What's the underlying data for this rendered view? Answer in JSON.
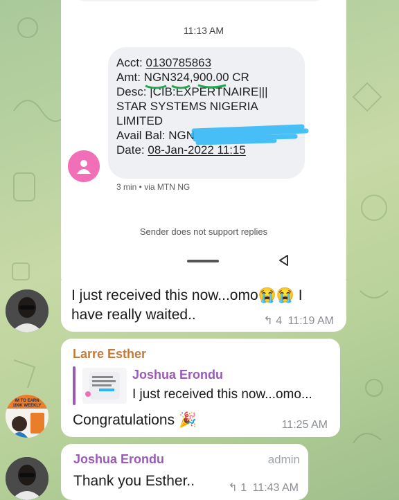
{
  "screenshot": {
    "time": "11:13 AM",
    "sms_lines": [
      "Acct: 0130785863",
      "Amt: NGN324,900.00 CR",
      "Desc: |CIB:EXPERTNAIRE|||",
      "STAR SYSTEMS NIGERIA",
      "LIMITED",
      "Avail Bal: NGN",
      "Date: 08-Jan-2022 11:15"
    ],
    "acct_label": "Acct: ",
    "acct_value": "0130785863",
    "amt_label": "Amt: ",
    "amt_value": "NGN324,900.00",
    "amt_suffix": " CR",
    "desc": "Desc: |CIB:EXPERTNAIRE|||",
    "desc2": "STAR SYSTEMS NIGERIA",
    "desc3": "LIMITED",
    "bal_label": "Avail Bal: NGN",
    "date_label": "Date: ",
    "date_value": "08-Jan-2022 11:15",
    "sms_meta": "3 min • via MTN NG",
    "no_reply": "Sender does not support replies"
  },
  "messages": [
    {
      "text_part1": "I just received this now...omo",
      "emoji": "😭😭",
      "text_part2": " I",
      "text_line2": "have really waited..",
      "reply_count": "4",
      "time": "11:19 AM"
    },
    {
      "sender": "Larre Esther",
      "quote_sender": "Joshua Erondu",
      "quote_text": "I just received this now...omo...",
      "text": "Congratulations",
      "emoji": "🎉",
      "time": "11:25 AM",
      "avatar_caption": "IM TO EARN\n100K WEEKLY"
    },
    {
      "sender": "Joshua Erondu",
      "role": "admin",
      "text": "Thank you Esther..",
      "reply_count": "1",
      "time": "11:43 AM"
    }
  ],
  "colors": {
    "larre_name": "#c47a3a",
    "joshua_name": "#9b59b6",
    "pink_avatar": "#f06fb6",
    "highlight_blue": "#29b6f6",
    "underline_green": "#20a84a"
  }
}
